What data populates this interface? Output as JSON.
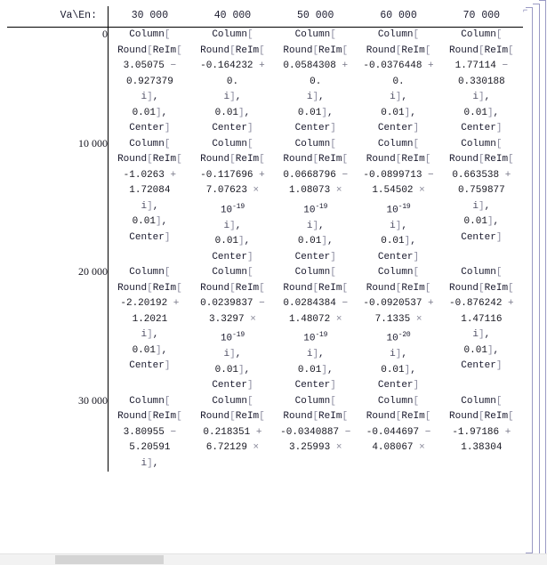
{
  "table": {
    "corner_label": "Va\\En:",
    "column_headers": [
      "30 000",
      "40 000",
      "50 000",
      "60 000",
      "70 000"
    ],
    "row_labels": [
      "0",
      "10 000",
      "20 000",
      "30 000"
    ],
    "cells": [
      [
        {
          "head1": "Column[",
          "head2": "Round[ReIm[",
          "re": "3.05075",
          "sign": "−",
          "im": "0.927379",
          "imtail": "i],",
          "round": "0.01],",
          "align": "Center]",
          "sci": null,
          "exp": null
        },
        {
          "head1": "Column[",
          "head2": "Round[ReIm[",
          "re": "-0.164232",
          "sign": "+",
          "im": "0.",
          "imtail": "i],",
          "round": "0.01],",
          "align": "Center]",
          "sci": null,
          "exp": null
        },
        {
          "head1": "Column[",
          "head2": "Round[ReIm[",
          "re": "0.0584308",
          "sign": "+",
          "im": "0.",
          "imtail": "i],",
          "round": "0.01],",
          "align": "Center]",
          "sci": null,
          "exp": null
        },
        {
          "head1": "Column[",
          "head2": "Round[ReIm[",
          "re": "-0.0376448",
          "sign": "+",
          "im": "0.",
          "imtail": "i],",
          "round": "0.01],",
          "align": "Center]",
          "sci": null,
          "exp": null
        },
        {
          "head1": "Column[",
          "head2": "Round[ReIm[",
          "re": "1.77114",
          "sign": "−",
          "im": "0.330188",
          "imtail": "i],",
          "round": "0.01],",
          "align": "Center]",
          "sci": null,
          "exp": null
        }
      ],
      [
        {
          "head1": "Column[",
          "head2": "Round[ReIm[",
          "re": "-1.0263",
          "sign": "+",
          "im": "1.72084",
          "imtail": "i],",
          "round": "0.01],",
          "align": "Center]",
          "sci": null,
          "exp": null
        },
        {
          "head1": "Column[",
          "head2": "Round[ReIm[",
          "re": "-0.117696",
          "sign": "+",
          "im": "7.07623",
          "imtail": "i],",
          "round": "0.01],",
          "align": "Center]",
          "sci": "×",
          "exp": "-19"
        },
        {
          "head1": "Column[",
          "head2": "Round[ReIm[",
          "re": "0.0668796",
          "sign": "−",
          "im": "1.08073",
          "imtail": "i],",
          "round": "0.01],",
          "align": "Center]",
          "sci": "×",
          "exp": "-19"
        },
        {
          "head1": "Column[",
          "head2": "Round[ReIm[",
          "re": "-0.0899713",
          "sign": "−",
          "im": "1.54502",
          "imtail": "i],",
          "round": "0.01],",
          "align": "Center]",
          "sci": "×",
          "exp": "-19"
        },
        {
          "head1": "Column[",
          "head2": "Round[ReIm[",
          "re": "0.663538",
          "sign": "+",
          "im": "0.759877",
          "imtail": "i],",
          "round": "0.01],",
          "align": "Center]",
          "sci": null,
          "exp": null
        }
      ],
      [
        {
          "head1": "Column[",
          "head2": "Round[ReIm[",
          "re": "-2.20192",
          "sign": "+",
          "im": "1.2021",
          "imtail": "i],",
          "round": "0.01],",
          "align": "Center]",
          "sci": null,
          "exp": null
        },
        {
          "head1": "Column[",
          "head2": "Round[ReIm[",
          "re": "0.0239837",
          "sign": "−",
          "im": "3.3297",
          "imtail": "i],",
          "round": "0.01],",
          "align": "Center]",
          "sci": "×",
          "exp": "-19"
        },
        {
          "head1": "Column[",
          "head2": "Round[ReIm[",
          "re": "0.0284384",
          "sign": "−",
          "im": "1.48072",
          "imtail": "i],",
          "round": "0.01],",
          "align": "Center]",
          "sci": "×",
          "exp": "-19"
        },
        {
          "head1": "Column[",
          "head2": "Round[ReIm[",
          "re": "-0.0920537",
          "sign": "+",
          "im": "7.1335",
          "imtail": "i],",
          "round": "0.01],",
          "align": "Center]",
          "sci": "×",
          "exp": "-20"
        },
        {
          "head1": "Column[",
          "head2": "Round[ReIm[",
          "re": "-0.876242",
          "sign": "+",
          "im": "1.47116",
          "imtail": "i],",
          "round": "0.01],",
          "align": "Center]",
          "sci": null,
          "exp": null
        }
      ],
      [
        {
          "head1": "Column[",
          "head2": "Round[ReIm[",
          "re": "3.80955",
          "sign": "−",
          "im": "5.20591",
          "imtail": "i],",
          "round": "",
          "align": "",
          "sci": null,
          "exp": null
        },
        {
          "head1": "Column[",
          "head2": "Round[ReIm[",
          "re": "0.218351",
          "sign": "+",
          "im": "6.72129",
          "imtail": "",
          "round": "",
          "align": "",
          "sci": "×",
          "exp": null
        },
        {
          "head1": "Column[",
          "head2": "Round[ReIm[",
          "re": "-0.0340887",
          "sign": "−",
          "im": "3.25993",
          "imtail": "",
          "round": "",
          "align": "",
          "sci": "×",
          "exp": null
        },
        {
          "head1": "Column[",
          "head2": "Round[ReIm[",
          "re": "-0.044697",
          "sign": "−",
          "im": "4.08067",
          "imtail": "",
          "round": "",
          "align": "",
          "sci": "×",
          "exp": null
        },
        {
          "head1": "Column[",
          "head2": "Round[ReIm[",
          "re": "-1.97186",
          "sign": "+",
          "im": "1.38304",
          "imtail": "",
          "round": "",
          "align": "",
          "sci": null,
          "exp": null
        }
      ]
    ]
  },
  "notebook": {
    "bracket_tag_glyph": "⌐",
    "scrollbar": {
      "visible": true
    }
  },
  "colors": {
    "text": "#1a1a2e",
    "bracket": "#8a8a9e",
    "cell_bracket": "#9a9ac4",
    "rule": "#000000",
    "scrollbar_track": "#f2f2f2",
    "scrollbar_thumb": "#d4d4d4"
  }
}
